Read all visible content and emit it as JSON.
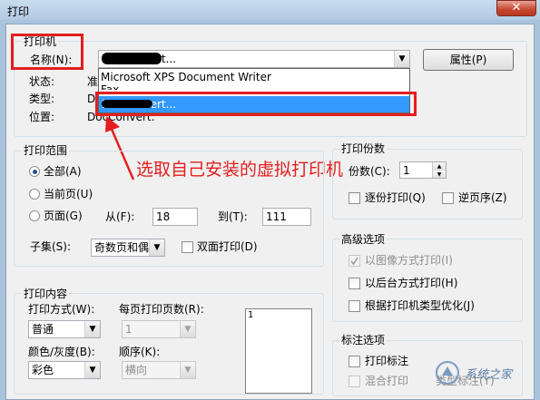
{
  "window": {
    "title": "打印",
    "close_glyph": "✕"
  },
  "printer_group": {
    "label": "打印机",
    "name_label": "名称(N):",
    "name_value": "DocConvert...",
    "status_label": "状态:",
    "status_value": "准",
    "type_label": "类型:",
    "type_value": "D",
    "location_label": "位置:",
    "location_value": "DocConvert:",
    "properties_button": "属性(P)",
    "dropdown_items": [
      "Microsoft XPS Document Writer",
      "Fax",
      "DocConvert..."
    ]
  },
  "annotation": {
    "text": "选取自己安装的虚拟打印机",
    "color": "#e41e1e"
  },
  "range_group": {
    "label": "打印范围",
    "all": "全部(A)",
    "current": "当前页(U)",
    "pages": "页面(G)",
    "from_label": "从(F):",
    "from_value": "18",
    "to_label": "到(T):",
    "to_value": "111",
    "subset_label": "子集(S):",
    "subset_value": "奇数页和偶",
    "duplex": "双面打印(D)"
  },
  "copies_group": {
    "label": "打印份数",
    "copies_label": "份数(C):",
    "copies_value": "1",
    "collate": "逐份打印(Q)",
    "reverse": "逆页序(Z)"
  },
  "advanced_group": {
    "label": "高级选项",
    "image_mode": "以图像方式打印(I)",
    "background": "以后台方式打印(H)",
    "optimize": "根据打印机类型优化(J)"
  },
  "content_group": {
    "label": "打印内容",
    "mode_label": "打印方式(W):",
    "mode_value": "普通",
    "pages_per_sheet_label": "每页打印页数(R):",
    "pages_per_sheet_value": "1",
    "color_label": "颜色/灰度(B):",
    "color_value": "彩色",
    "order_label": "顺序(K):",
    "order_value": "横向",
    "preview_page": "1"
  },
  "annotation_group": {
    "label": "标注选项",
    "print_annotations": "打印标注",
    "mixed": "混合打印",
    "type_label": "类型标注(Y)"
  },
  "watermark": {
    "text": "系统之家"
  }
}
